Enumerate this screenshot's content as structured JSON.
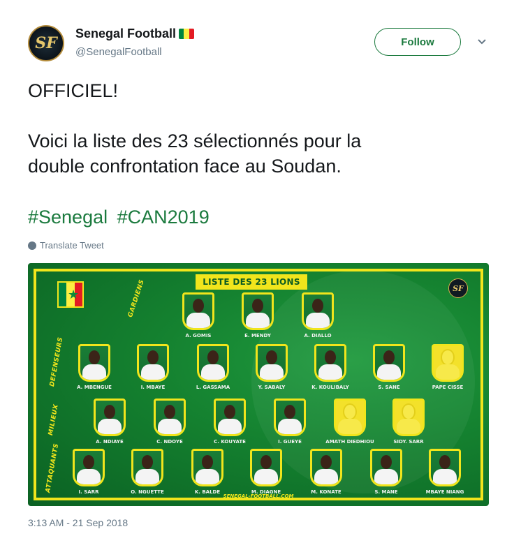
{
  "account": {
    "display_name": "Senegal Football",
    "handle": "@SenegalFootball",
    "avatar_monogram": "SF",
    "flag_colors": [
      "#00853f",
      "#fdef42",
      "#e31b23"
    ]
  },
  "header": {
    "follow_label": "Follow",
    "menu_icon": "chevron-down-icon"
  },
  "tweet": {
    "line1": "OFFICIEL!",
    "line2": "Voici la liste des 23 sélectionnés pour la",
    "line3": "double confrontation face au Soudan.",
    "hashtags": [
      "#Senegal",
      "#CAN2019"
    ],
    "translate_label": "Translate Tweet",
    "timestamp": "3:13 AM - 21 Sep 2018"
  },
  "media": {
    "title": "LISTE DES 23 LIONS",
    "logo_monogram": "SF",
    "footer_url": "SENEGAL-FOOTBALL.COM",
    "positions": {
      "goalkeepers": "GARDIENS",
      "defenders": "DEFENSEURS",
      "midfielders": "MILIEUX",
      "forwards": "ATTAQUANTS"
    },
    "goalkeepers": [
      "A. GOMIS",
      "E. MENDY",
      "A. DIALLO"
    ],
    "defenders": [
      "A. MBENGUE",
      "I. MBAYE",
      "L. GASSAMA",
      "Y. SABALY",
      "K. KOULIBALY",
      "S. SANE",
      "PAPE CISSE"
    ],
    "midfielders": [
      "A. NDIAYE",
      "C. NDOYE",
      "C. KOUYATE",
      "I. GUEYE",
      "AMATH DIEDHIOU",
      "SIDY. SARR"
    ],
    "forwards": [
      "I. SARR",
      "O. NGUETTE",
      "K. BALDE",
      "M. DIAGNE",
      "M. KONATE",
      "S. MANE",
      "MBAYE NIANG"
    ],
    "colors": {
      "pitch": "#14802f",
      "frame": "#f1e51c"
    }
  }
}
